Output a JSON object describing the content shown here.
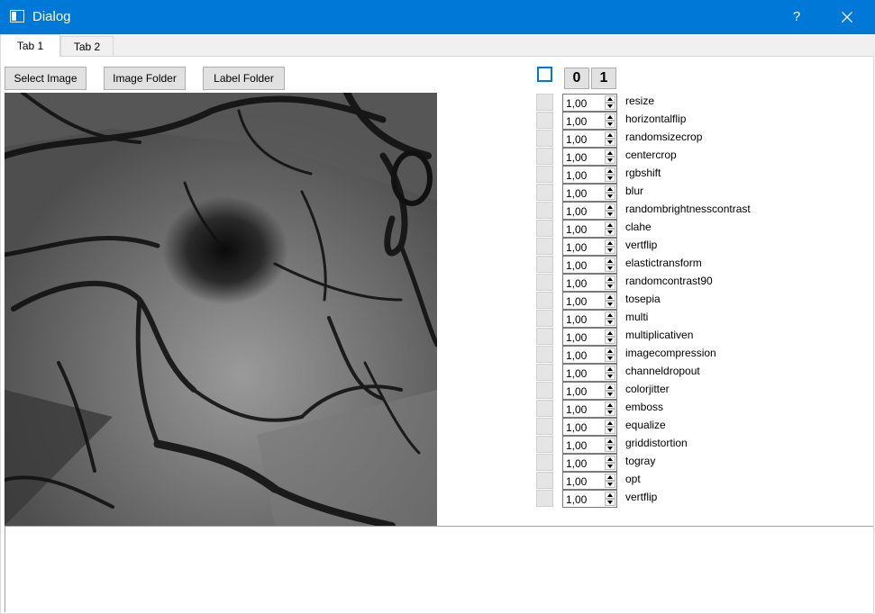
{
  "window": {
    "title": "Dialog",
    "help_label": "?"
  },
  "tabs": [
    {
      "label": "Tab 1"
    },
    {
      "label": "Tab 2"
    }
  ],
  "toolbar": {
    "select_image": "Select Image",
    "image_folder": "Image Folder",
    "label_folder": "Label Folder"
  },
  "header_buttons": {
    "zero": "0",
    "one": "1"
  },
  "augmentations": [
    {
      "label": "resize",
      "value": "1,00"
    },
    {
      "label": "horizontalflip",
      "value": "1,00"
    },
    {
      "label": "randomsizecrop",
      "value": "1,00"
    },
    {
      "label": "centercrop",
      "value": "1,00"
    },
    {
      "label": "rgbshift",
      "value": "1,00"
    },
    {
      "label": "blur",
      "value": "1,00"
    },
    {
      "label": "randombrightnesscontrast",
      "value": "1,00"
    },
    {
      "label": "clahe",
      "value": "1,00"
    },
    {
      "label": "vertflip",
      "value": "1,00"
    },
    {
      "label": "elastictransform",
      "value": "1,00"
    },
    {
      "label": "randomcontrast90",
      "value": "1,00"
    },
    {
      "label": "tosepia",
      "value": "1,00"
    },
    {
      "label": "multi",
      "value": "1,00"
    },
    {
      "label": "multiplicativen",
      "value": "1,00"
    },
    {
      "label": "imagecompression",
      "value": "1,00"
    },
    {
      "label": "channeldropout",
      "value": "1,00"
    },
    {
      "label": "colorjitter",
      "value": "1,00"
    },
    {
      "label": "emboss",
      "value": "1,00"
    },
    {
      "label": "equalize",
      "value": "1,00"
    },
    {
      "label": "griddistortion",
      "value": "1,00"
    },
    {
      "label": "togray",
      "value": "1,00"
    },
    {
      "label": "opt",
      "value": "1,00"
    },
    {
      "label": "vertflip",
      "value": "1,00"
    }
  ],
  "colors": {
    "titlebar": "#0078d7",
    "accent": "#0078d7"
  }
}
